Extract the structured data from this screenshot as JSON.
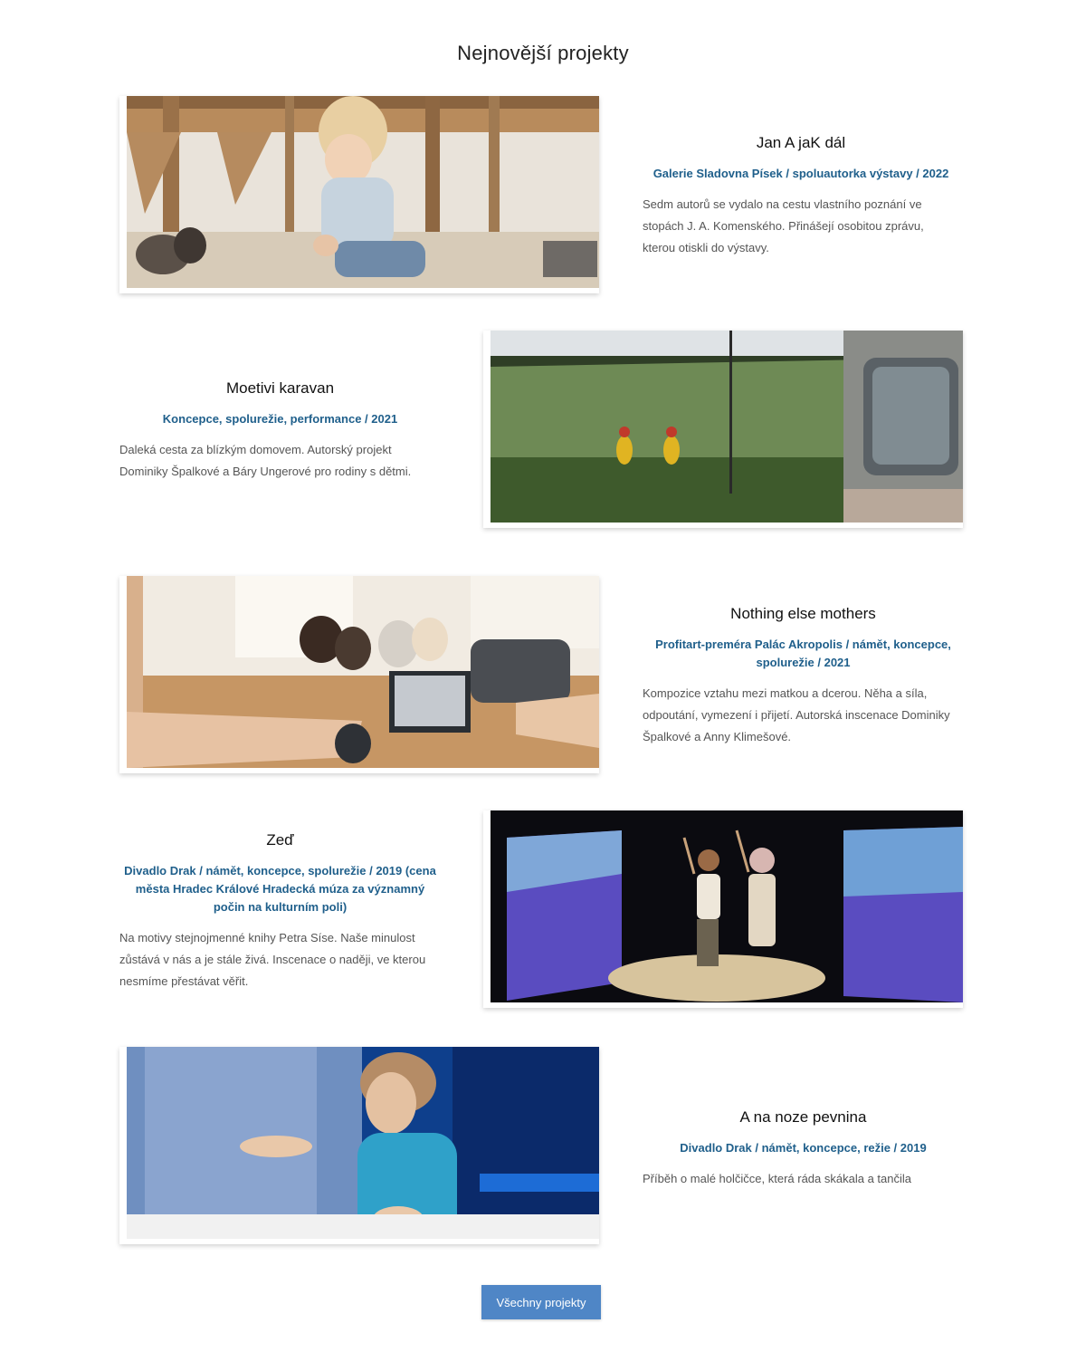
{
  "section": {
    "title": "Nejnovější projekty"
  },
  "projects": [
    {
      "title": "Jan A jaK dál",
      "meta": "Galerie Sladovna Písek / spoluautorka výstavy / 2022",
      "desc": "Sedm autorů se vydalo na cestu vlastního poznání ve stopách J. A. Komenského. Přinášejí osobitou zprávu, kterou otiskli do výstavy.",
      "image_alt": "Child crouching in wooden gallery hall"
    },
    {
      "title": "Moetivi karavan",
      "meta": "Koncepce, spolurežie, performance / 2021",
      "desc": "Daleká cesta za blízkým domovem. Autorský projekt Dominiky Špalkové a Báry Ungerové pro rodiny s dětmi.",
      "image_alt": "Two figures in yellow raincoats walking through green field"
    },
    {
      "title": "Nothing else mothers",
      "meta": "Profitart-preméra Palác Akropolis / námět, koncepce, spolurežie / 2021",
      "desc": "Kompozice vztahu mezi matkou a dcerou. Něha a síla, odpoutání, vymezení i přijetí. Autorská inscenace Dominiky Špalkové a Anny Klimešové.",
      "image_alt": "Mothers and children sitting on floor with laptop"
    },
    {
      "title": "Zeď",
      "meta": "Divadlo Drak / námět, koncepce, spolurežie / 2019 (cena města Hradec Králové Hradecká múza za významný počin na kulturním poli)",
      "desc": "Na motivy stejnojmenné knihy Petra Síse. Naše minulost zůstává v nás a je stále živá. Inscenace o naději, ve kterou nesmíme přestávat věřit.",
      "image_alt": "Two performers on stage with purple projections"
    },
    {
      "title": "A na noze pevnina",
      "meta": "Divadlo Drak / námět, koncepce, režie / 2019",
      "desc": "Příběh o malé holčičce, která ráda skákala a tančila",
      "image_alt": "Performer with curly hair in blue top"
    }
  ],
  "button": {
    "label": "Všechny projekty"
  }
}
